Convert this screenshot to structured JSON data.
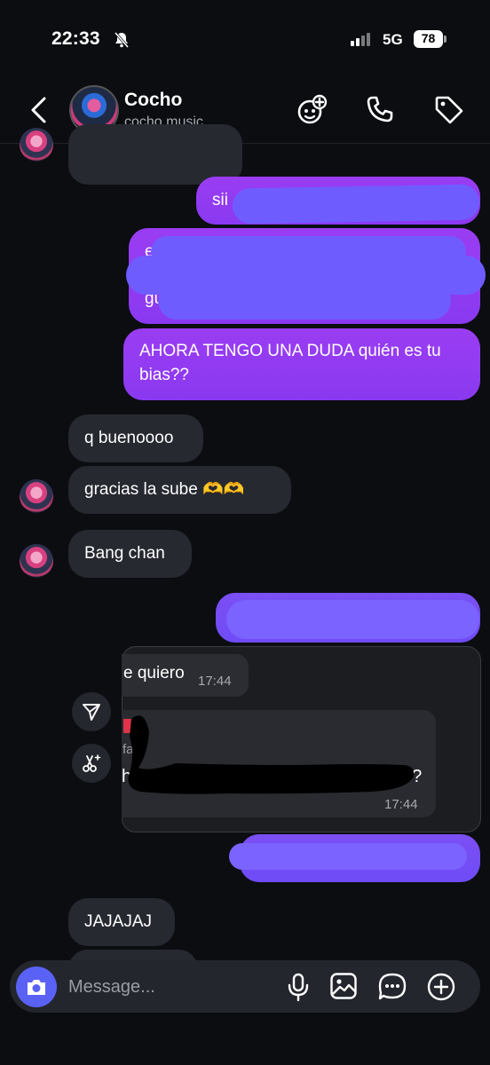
{
  "status_bar": {
    "time": "22:33",
    "network": "5G",
    "battery": "78"
  },
  "header": {
    "name": "Cocho",
    "username": "cocho.music"
  },
  "messages": {
    "sent_1": "sii",
    "sent_2_fragment": "ese",
    "sent_2_fragment_b": "gu",
    "sent_3": "AHORA TENGO UNA DUDA quién es tu bias??",
    "recv_1": "q buenoooo",
    "recv_2": "gracias la sube 🫶🫶",
    "recv_3": "Bang chan",
    "forward_text_1": "e quiero",
    "forward_time_1": "17:44",
    "forward_text_2_a": "fa",
    "forward_text_2_b": "h",
    "forward_text_2_c": "o?",
    "forward_time_2": "17:44",
    "recv_4": "JAJAJAJ"
  },
  "composer": {
    "placeholder": "Message..."
  },
  "colors": {
    "sent": "#8b3cf0",
    "sent_blue": "#6f4cf6",
    "received": "#262930",
    "accent": "#5a62f5",
    "background": "#0b0d11"
  }
}
